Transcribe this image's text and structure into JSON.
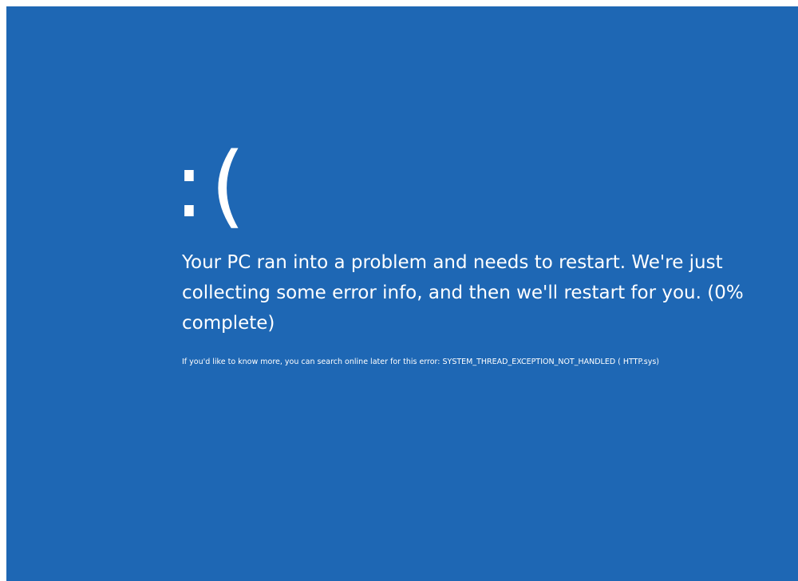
{
  "screen": {
    "background_color": "#1e67b4",
    "text_color": "#ffffff",
    "frown_icon_text": ":(",
    "message": "Your PC ran into a problem and needs to restart. We're just collecting some error info, and then we'll restart for you. (0% complete)",
    "progress_percent": 0,
    "more_info": "If you'd like to know more, you can search online later for this error: SYSTEM_THREAD_EXCEPTION_NOT_HANDLED ( HTTP.sys)"
  }
}
